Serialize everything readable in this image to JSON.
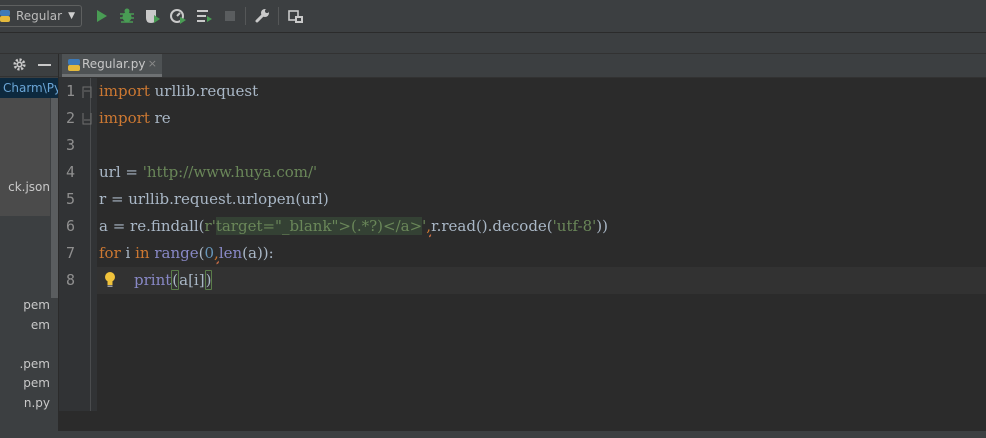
{
  "toolbar": {
    "run_config_label": "Regular",
    "buttons": [
      {
        "name": "run-icon",
        "color": "#499c54"
      },
      {
        "name": "debug-icon",
        "color": "#499c54"
      },
      {
        "name": "coverage-icon",
        "color": "#c9c9c9"
      },
      {
        "name": "profile-icon",
        "color": "#c9c9c9"
      },
      {
        "name": "concurrency-icon",
        "color": "#c9c9c9"
      },
      {
        "name": "stop-icon",
        "color": "#5a5d5f"
      },
      {
        "name": "wrench-icon",
        "color": "#c9c9c9"
      },
      {
        "name": "sdk-icon",
        "color": "#c9c9c9"
      }
    ]
  },
  "project_panel": {
    "path_text": "Charm\\Py",
    "items": [
      {
        "label": "ck.json"
      },
      {
        "label": "pem"
      },
      {
        "label": "em"
      },
      {
        "label": ".pem"
      },
      {
        "label": "pem"
      },
      {
        "label": "n.py"
      }
    ]
  },
  "editor": {
    "tab_label": "Regular.py",
    "tab_close": "×",
    "line_numbers": [
      "1",
      "2",
      "3",
      "4",
      "5",
      "6",
      "7",
      "8"
    ],
    "code": {
      "l1_kw": "import",
      "l1_rest": " urllib.request",
      "l2_kw": "import",
      "l2_rest": " re",
      "l4_a": "url = ",
      "l4_str": "'http://www.huya.com/'",
      "l5": "r = urllib.request.urlopen(url)",
      "l6_a": "a = re.findall(",
      "l6_b": "r'",
      "l6_c": "target=\"_blank\">(.*?)</a>",
      "l6_d": "'",
      "l6_e": ",",
      "l6_f": "r.read().decode(",
      "l6_g": "'utf-8'",
      "l6_h": "))",
      "l7_for": "for",
      "l7_i": " i ",
      "l7_in": "in",
      "l7_sp": " ",
      "l7_range": "range",
      "l7_p1": "(",
      "l7_zero": "0",
      "l7_comma": ",",
      "l7_len": "len",
      "l7_rest": "(a)):",
      "l8_print": "print",
      "l8_p1": "(",
      "l8_mid": "a[i]",
      "l8_p2": ")"
    }
  },
  "colors": {
    "background": "#2b2b2b",
    "keyword": "#cc7832",
    "string": "#6a8759",
    "number": "#6897bb",
    "builtin": "#8888c6",
    "identifier": "#a9b7c6"
  }
}
